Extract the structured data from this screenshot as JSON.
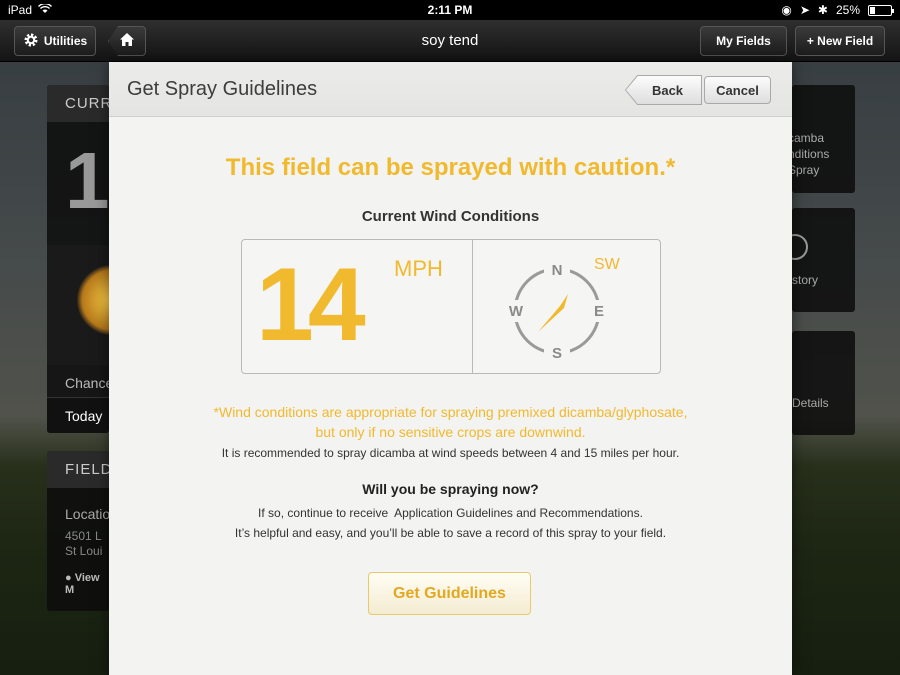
{
  "status_bar": {
    "device": "iPad",
    "time": "2:11 PM",
    "battery": "25%"
  },
  "nav": {
    "utilities_label": "Utilities",
    "title": "soy tend",
    "my_fields_label": "My Fields",
    "new_field_label": "+ New Field"
  },
  "background": {
    "left_card_header": "CURR",
    "big_number": "1",
    "chance_label": "Chance",
    "today_label": "Today",
    "field_header": "FIELD",
    "location_label": "Locatio",
    "address_line1": "4501 L",
    "address_line2": "St Loui",
    "view_map_label": "View M",
    "right_card1_lines": [
      "camba",
      "nditions",
      "Spray"
    ],
    "right_card2_label": "story",
    "right_card3_label": "Details"
  },
  "modal": {
    "title": "Get Spray Guidelines",
    "back_label": "Back",
    "cancel_label": "Cancel",
    "headline": "This field can be sprayed with caution.*",
    "wind_title": "Current Wind Conditions",
    "wind_speed": "14",
    "wind_unit": "MPH",
    "wind_direction": "SW",
    "compass": {
      "n": "N",
      "s": "S",
      "e": "E",
      "w": "W"
    },
    "caution_line1": "*Wind conditions are appropriate for spraying premixed dicamba/glyphosate,",
    "caution_line2": "but only if no sensitive crops are downwind.",
    "recommendation": "It is recommended to spray dicamba at wind speeds between 4 and 15 miles per hour.",
    "question": "Will you be spraying now?",
    "info_line1": "If so, continue to receive  Application Guidelines and Recommendations.",
    "info_line2": "It’s helpful and easy, and you’ll be able to save a record of this spray to your field.",
    "guidelines_button": "Get Guidelines"
  },
  "colors": {
    "accent": "#f1b92e",
    "modal_bg": "#f3f3f1"
  }
}
